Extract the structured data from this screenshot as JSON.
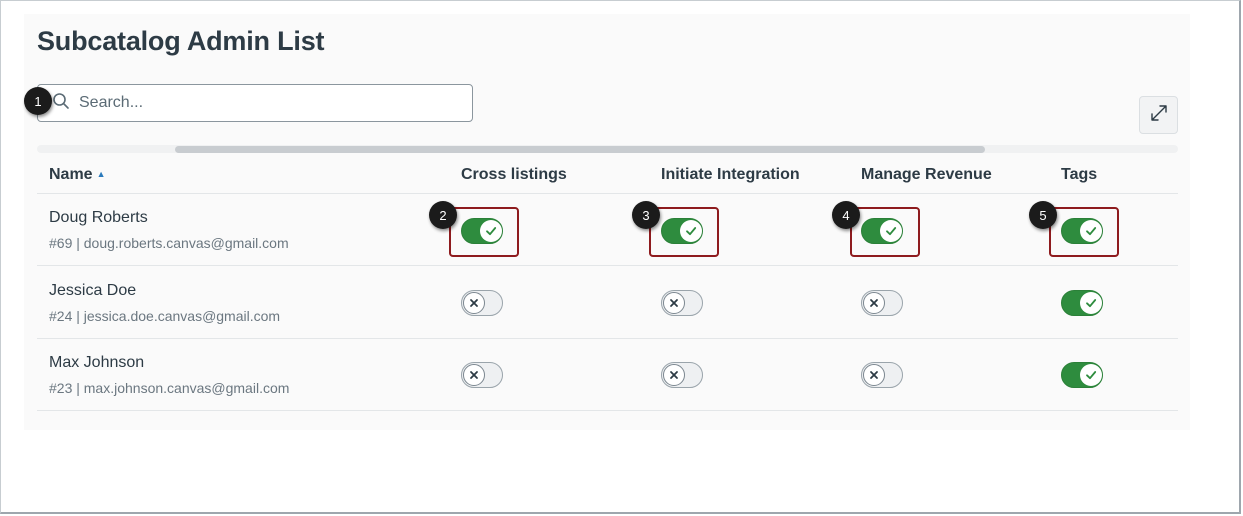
{
  "title": "Subcatalog Admin List",
  "search": {
    "placeholder": "Search...",
    "value": ""
  },
  "columns": {
    "name": "Name",
    "cross_listings": "Cross listings",
    "initiate_integration": "Initiate Integration",
    "manage_revenue": "Manage Revenue",
    "tags": "Tags"
  },
  "rows": [
    {
      "name": "Doug Roberts",
      "detail": "#69 | doug.roberts.canvas@gmail.com",
      "cross_listings": true,
      "initiate_integration": true,
      "manage_revenue": true,
      "tags": true
    },
    {
      "name": "Jessica Doe",
      "detail": "#24 | jessica.doe.canvas@gmail.com",
      "cross_listings": false,
      "initiate_integration": false,
      "manage_revenue": false,
      "tags": true
    },
    {
      "name": "Max Johnson",
      "detail": "#23 | max.johnson.canvas@gmail.com",
      "cross_listings": false,
      "initiate_integration": false,
      "manage_revenue": false,
      "tags": true
    }
  ],
  "callouts": [
    "1",
    "2",
    "3",
    "4",
    "5"
  ],
  "colors": {
    "toggle_on": "#2e8c3e",
    "highlight": "#8e1b1e",
    "sort_arrow": "#2b7abc"
  },
  "icons": {
    "search": "search-icon",
    "expand": "expand-icon",
    "check": "checkmark-icon",
    "x": "x-icon"
  }
}
